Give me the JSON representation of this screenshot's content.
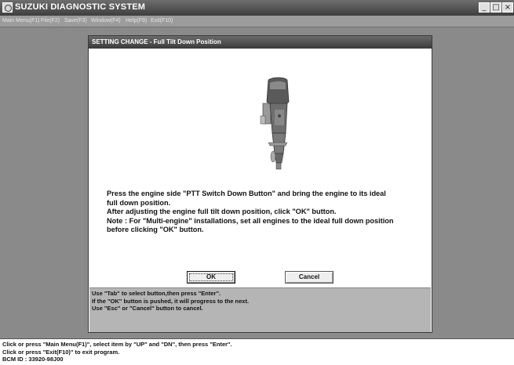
{
  "window": {
    "title": "SUZUKI DIAGNOSTIC SYSTEM",
    "icon": "app-icon",
    "controls": {
      "minimize": "_",
      "maximize": "□",
      "close": "×"
    }
  },
  "menubar": {
    "items": [
      "Main Menu(F1)",
      "File(F2)",
      "Save(F3)",
      "Window(F4)",
      "Help(F9)",
      "Exit(F10)"
    ]
  },
  "dialog": {
    "title": "SETTING CHANGE -   Full Tilt Down Position",
    "image": "outboard-engine-illustration",
    "message_lines": [
      "Press the engine side \"PTT Switch Down Button\" and bring the engine to its ideal",
      "full down position.",
      "After adjusting the engine full tilt down position, click \"OK\" button.",
      "Note : For \"Multi-engine\" installations, set all engines to the ideal full down position",
      "before clicking \"OK\" button."
    ],
    "buttons": {
      "ok": "OK",
      "cancel": "Cancel"
    },
    "help_lines": [
      "Use \"Tab\" to select button,then press \"Enter\".",
      "If the \"OK\" button is pushed, it will progress to the next.",
      "Use \"Esc\" or \"Cancel\" button to cancel."
    ]
  },
  "statusbar": {
    "lines": [
      "Click or press \"Main Menu(F1)\", select item by \"UP\" and \"DN\", then press \"Enter\".",
      "Click or press \"Exit(F10)\" to exit program.",
      "BCM ID : 33920-98J00"
    ]
  }
}
